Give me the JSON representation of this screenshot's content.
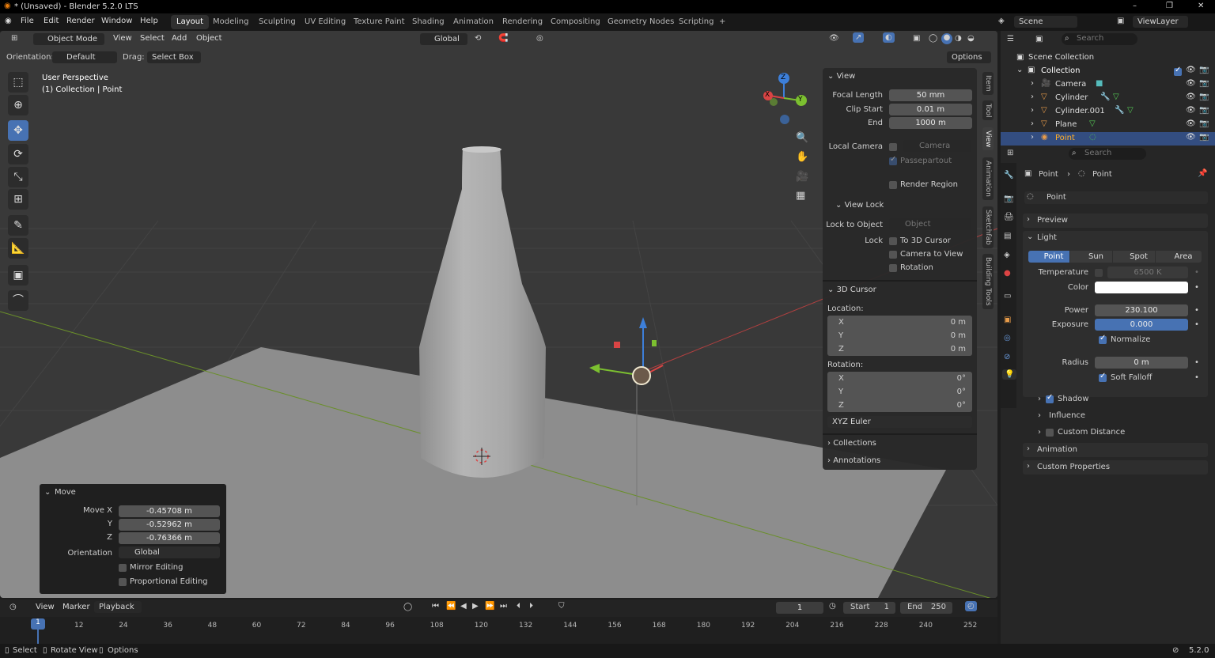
{
  "titlebar": {
    "title": "* (Unsaved) - Blender 5.2.0 LTS",
    "minimize": "–",
    "restore": "❐",
    "close": "✕"
  },
  "menu": {
    "items": [
      "File",
      "Edit",
      "Render",
      "Window",
      "Help"
    ]
  },
  "workspaces": {
    "tabs": [
      "Layout",
      "Modeling",
      "Sculpting",
      "UV Editing",
      "Texture Paint",
      "Shading",
      "Animation",
      "Rendering",
      "Compositing",
      "Geometry Nodes",
      "Scripting"
    ],
    "add": "+"
  },
  "scene": {
    "label": "Scene",
    "viewlayer": "ViewLayer"
  },
  "viewport_header": {
    "mode": "Object Mode",
    "view": "View",
    "select": "Select",
    "add": "Add",
    "object": "Object",
    "transform": "Global"
  },
  "tool_settings": {
    "orientation_label": "Orientation:",
    "orientation": "Default",
    "drag_label": "Drag:",
    "drag": "Select Box",
    "options": "Options"
  },
  "overlay_text": {
    "perspective": "User Perspective",
    "context": "(1) Collection | Point"
  },
  "gizmo": {
    "z": "Z",
    "y": "Y",
    "x": "X"
  },
  "npanel": {
    "tabs": [
      "Item",
      "Tool",
      "View",
      "Animation",
      "Sketchfab",
      "Building Tools"
    ],
    "view": {
      "title": "View",
      "focal_length_label": "Focal Length",
      "focal_length": "50 mm",
      "clip_start_label": "Clip Start",
      "clip_start": "0.01 m",
      "end_label": "End",
      "end": "1000 m",
      "local_camera_label": "Local Camera",
      "camera": "Camera",
      "passepartout": "Passepartout",
      "render_region": "Render Region"
    },
    "view_lock": {
      "title": "View Lock",
      "lock_to_object_label": "Lock to Object",
      "object_placeholder": "Object",
      "lock_label": "Lock",
      "to_3d_cursor": "To 3D Cursor",
      "camera_to_view": "Camera to View",
      "rotation": "Rotation"
    },
    "cursor": {
      "title": "3D Cursor",
      "location_label": "Location:",
      "x": "0 m",
      "y": "0 m",
      "z": "0 m",
      "rotation_label": "Rotation:",
      "rx": "0°",
      "ry": "0°",
      "rz": "0°",
      "mode": "XYZ Euler"
    },
    "axes": [
      "X",
      "Y",
      "Z"
    ],
    "collections": "Collections",
    "annotations": "Annotations"
  },
  "move_panel": {
    "title": "Move",
    "move_x_label": "Move X",
    "y_label": "Y",
    "z_label": "Z",
    "x": "-0.45708 m",
    "y": "-0.52962 m",
    "z": "-0.76366 m",
    "orientation_label": "Orientation",
    "orientation": "Global",
    "mirror": "Mirror Editing",
    "proportional": "Proportional Editing"
  },
  "outliner": {
    "search_placeholder": "Search",
    "scene_collection": "Scene Collection",
    "items": [
      "Collection",
      "Camera",
      "Cylinder",
      "Cylinder.001",
      "Plane",
      "Point"
    ]
  },
  "properties": {
    "search_placeholder": "Search",
    "breadcrumb_obj": "Point",
    "breadcrumb_data": "Point",
    "datablock": "Point",
    "preview": "Preview",
    "light": "Light",
    "light_types": [
      "Point",
      "Sun",
      "Spot",
      "Area"
    ],
    "temperature_label": "Temperature",
    "temperature": "6500 K",
    "color_label": "Color",
    "power_label": "Power",
    "power": "230.100",
    "exposure_label": "Exposure",
    "exposure": "0.000",
    "normalize": "Normalize",
    "radius_label": "Radius",
    "radius": "0 m",
    "soft_falloff": "Soft Falloff",
    "shadow": "Shadow",
    "influence": "Influence",
    "custom_distance": "Custom Distance",
    "animation": "Animation",
    "custom_properties": "Custom Properties"
  },
  "timeline": {
    "view": "View",
    "marker": "Marker",
    "playback": "Playback",
    "current_frame": "1",
    "start_label": "Start",
    "start": "1",
    "end_label": "End",
    "end": "250",
    "playhead": "1",
    "ticks": [
      "12",
      "24",
      "36",
      "48",
      "60",
      "72",
      "84",
      "96",
      "108",
      "120",
      "132",
      "144",
      "156",
      "168",
      "180",
      "192",
      "204",
      "216",
      "228",
      "240",
      "252"
    ]
  },
  "statusbar": {
    "select": "Select",
    "rotate": "Rotate View",
    "options": "Options",
    "version": "5.2.0"
  }
}
